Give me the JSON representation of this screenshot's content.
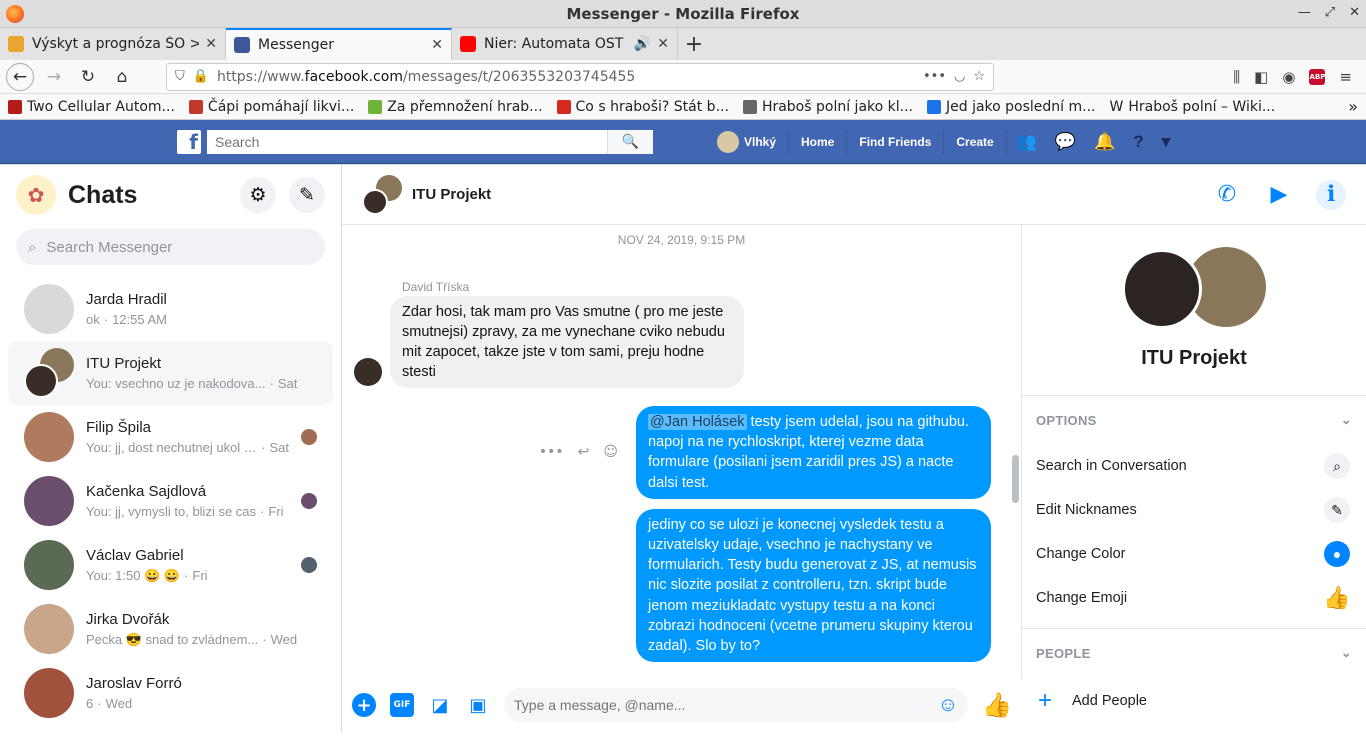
{
  "window": {
    "title": "Messenger - Mozilla Firefox"
  },
  "tabs": [
    {
      "label": "Výskyt a prognóza ŠO >",
      "active": false,
      "color": "#e8a630"
    },
    {
      "label": "Messenger",
      "active": true,
      "color": "#3b5998"
    },
    {
      "label": "Nier: Automata OST - F",
      "active": false,
      "color": "#ff0000"
    }
  ],
  "nav": {
    "url_prefix": "https://www.",
    "url_domain": "facebook.com",
    "url_path": "/messages/t/2063553203745455"
  },
  "bookmarks": [
    {
      "label": "Two Cellular Autom...",
      "color": "#b31b1b"
    },
    {
      "label": "Čápi pomáhají likvi...",
      "color": "#c0392b"
    },
    {
      "label": "Za přemnožení hrab...",
      "color": "#6fb33b"
    },
    {
      "label": "Co s hraboši? Stát b...",
      "color": "#d42a1e"
    },
    {
      "label": "Hraboš polní jako kl...",
      "color": "#666666"
    },
    {
      "label": "Jed jako poslední m...",
      "color": "#1a73e8"
    },
    {
      "label": "Hraboš polní – Wiki...",
      "color": "#333333"
    }
  ],
  "fb": {
    "search_placeholder": "Search",
    "user": "Vlhký",
    "nav_items": [
      "Home",
      "Find Friends",
      "Create"
    ]
  },
  "chats": {
    "title": "Chats",
    "search_placeholder": "Search Messenger",
    "items": [
      {
        "name": "Jarda Hradil",
        "preview": "ok",
        "time": "12:55 AM",
        "avatar_color": "#d9d9d9",
        "seen_color": ""
      },
      {
        "name": "ITU Projekt",
        "preview": "You: vsechno uz je nakodova...",
        "time": "Sat",
        "avatar_color": "#8a7658",
        "seen_color": ""
      },
      {
        "name": "Filip Špila",
        "preview": "You: jj, dost nechutnej ukol d...",
        "time": "Sat",
        "avatar_color": "#b07a5e",
        "seen_color": "#a06a55"
      },
      {
        "name": "Kačenka Sajdlová",
        "preview": "You: jj, vymysli to, blizi se cas",
        "time": "Fri",
        "avatar_color": "#6b4e6e",
        "seen_color": "#6b4e6e"
      },
      {
        "name": "Václav Gabriel",
        "preview": "You: 1:50 😀 😀",
        "time": "Fri",
        "avatar_color": "#5a6a55",
        "seen_color": "#556070"
      },
      {
        "name": "Jirka Dvořák",
        "preview": "Pecka 😎 snad to zvládnem...",
        "time": "Wed",
        "avatar_color": "#c9a68a",
        "seen_color": ""
      },
      {
        "name": "Jaroslav Forró",
        "preview": "6",
        "time": "Wed",
        "avatar_color": "#a0523d",
        "seen_color": ""
      }
    ]
  },
  "conversation": {
    "title": "ITU Projekt",
    "timestamp": "NOV 24, 2019, 9:15 PM",
    "sender": "David Tříska",
    "incoming": "Zdar hosi, tak mam pro Vas smutne ( pro me jeste smutnejsi) zpravy, za me vynechane cviko nebudu mit zapocet, takze jste v tom sami, preju hodne stesti",
    "out1_mention": "@Jan Holásek",
    "out1_text": " testy jsem udelal, jsou na githubu. napoj na ne rychloskript, kterej vezme data formulare (posilani jsem zaridil pres JS) a nacte dalsi test.",
    "out2_text": "jediny co se ulozi je konecnej vysledek testu a uzivatelsky udaje, vsechno je nachystany ve formularich. Testy budu generovat z JS, at nemusis nic slozite posilat z controlleru, tzn. skript bude jenom meziukladatc vystupy testu a na konci zobrazi hodnoceni (vcetne prumeru skupiny kterou zadal). Slo by to?",
    "composer_placeholder": "Type a message, @name..."
  },
  "details": {
    "name": "ITU Projekt",
    "options_header": "OPTIONS",
    "options": [
      "Search in Conversation",
      "Edit Nicknames",
      "Change Color",
      "Change Emoji"
    ],
    "people_header": "PEOPLE",
    "add_people": "Add People"
  },
  "colors": {
    "fb_blue": "#4267b2",
    "messenger_blue": "#0099ff"
  }
}
